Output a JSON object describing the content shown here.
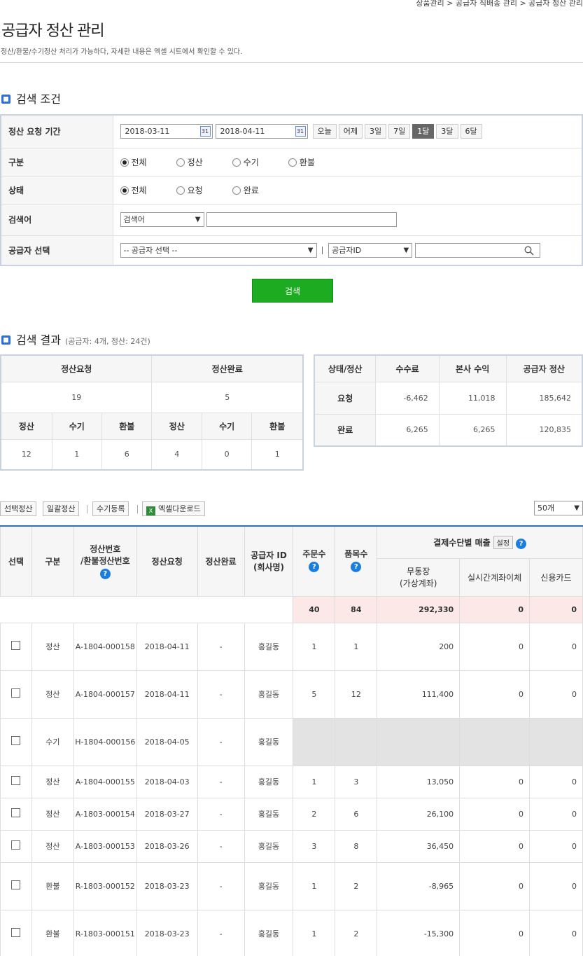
{
  "breadcrumb": "상품관리 > 공급자 직배송 관리 > 공급자 정산 관리",
  "title": "공급자 정산 관리",
  "description": "정산/환불/수기정산 처리가 가능하다, 자세한 내용은 엑셀 시트에서 확인할 수 있다.",
  "search_section": {
    "title": "검색 조건"
  },
  "search": {
    "period_label": "정산 요청 기간",
    "date_from": "2018-03-11",
    "date_to": "2018-04-11",
    "calendar_icon_text": "31",
    "period_buttons": [
      "오늘",
      "어제",
      "3일",
      "7일",
      "1달",
      "3달",
      "6달"
    ],
    "active_period": "1달",
    "type_label": "구분",
    "type_options": [
      "전체",
      "정산",
      "수기",
      "환불"
    ],
    "type_selected": "전체",
    "status_label": "상태",
    "status_options": [
      "전체",
      "요청",
      "완료"
    ],
    "status_selected": "전체",
    "keyword_label": "검색어",
    "keyword_select": "검색어",
    "keyword_value": "",
    "supplier_label": "공급자 선택",
    "supplier_select": "-- 공급자 선택 --",
    "supplier_id_select": "공급자ID",
    "supplier_search_value": "",
    "search_button": "검색"
  },
  "result_section": {
    "title": "검색 결과",
    "subtitle": "(공급자: 4개, 정산: 24건)"
  },
  "summary1": {
    "groups": [
      "정산요청",
      "정산완료"
    ],
    "group_totals": [
      "19",
      "5"
    ],
    "sub_headers": [
      "정산",
      "수기",
      "환불",
      "정산",
      "수기",
      "환불"
    ],
    "sub_values": [
      "12",
      "1",
      "6",
      "4",
      "0",
      "1"
    ]
  },
  "summary2": {
    "headers": [
      "상태/정산",
      "수수료",
      "본사 수익",
      "공급자 정산"
    ],
    "rows": [
      {
        "label": "요청",
        "fee": "-6,462",
        "hq": "11,018",
        "supplier": "185,642"
      },
      {
        "label": "완료",
        "fee": "6,265",
        "hq": "6,265",
        "supplier": "120,835"
      }
    ]
  },
  "actions": {
    "select_settle": "선택정산",
    "bulk_settle": "일괄정산",
    "manual_register": "수기등록",
    "excel_download": "엑셀다운로드",
    "excel_icon_text": "X",
    "page_size": "50개"
  },
  "list": {
    "headers": {
      "select": "선택",
      "type": "구분",
      "number_1": "정산번호",
      "number_2": "/환불정산번호",
      "request": "정산요청",
      "complete": "정산완료",
      "supplier_1": "공급자 ID",
      "supplier_2": "(회사명)",
      "orders": "주문수",
      "items": "품목수",
      "payment": "결제수단별 매출",
      "settings": "설정",
      "bank_1": "무통장",
      "bank_2": "(가상계좌)",
      "realtime": "실시간계좌이체",
      "card": "신용카드"
    },
    "help_icon": "?",
    "totals": {
      "orders": "40",
      "items": "84",
      "bank": "292,330",
      "realtime": "0",
      "card": "0"
    },
    "rows": [
      {
        "type": "정산",
        "number": "A-1804-000158",
        "request": "2018-04-11",
        "complete": "-",
        "supplier": "홍길동",
        "orders": "1",
        "items": "1",
        "bank": "200",
        "realtime": "0",
        "card": "0"
      },
      {
        "type": "정산",
        "number": "A-1804-000157",
        "request": "2018-04-11",
        "complete": "-",
        "supplier": "홍길동",
        "orders": "5",
        "items": "12",
        "bank": "111,400",
        "realtime": "0",
        "card": "0"
      },
      {
        "type": "수기",
        "number": "H-1804-000156",
        "request": "2018-04-05",
        "complete": "-",
        "supplier": "홍길동",
        "orders": "",
        "items": "",
        "bank": "",
        "realtime": "",
        "card": ""
      },
      {
        "type": "정산",
        "number": "A-1804-000155",
        "request": "2018-04-03",
        "complete": "-",
        "supplier": "홍길동",
        "orders": "1",
        "items": "3",
        "bank": "13,050",
        "realtime": "0",
        "card": "0"
      },
      {
        "type": "정산",
        "number": "A-1803-000154",
        "request": "2018-03-27",
        "complete": "-",
        "supplier": "홍길동",
        "orders": "2",
        "items": "6",
        "bank": "26,100",
        "realtime": "0",
        "card": "0"
      },
      {
        "type": "정산",
        "number": "A-1803-000153",
        "request": "2018-03-26",
        "complete": "-",
        "supplier": "홍길동",
        "orders": "3",
        "items": "8",
        "bank": "36,450",
        "realtime": "0",
        "card": "0"
      },
      {
        "type": "환불",
        "number": "R-1803-000152",
        "request": "2018-03-23",
        "complete": "-",
        "supplier": "홍길동",
        "orders": "1",
        "items": "2",
        "bank": "-8,965",
        "realtime": "0",
        "card": "0"
      },
      {
        "type": "환불",
        "number": "R-1803-000151",
        "request": "2018-03-23",
        "complete": "-",
        "supplier": "홍길동",
        "orders": "1",
        "items": "2",
        "bank": "-15,300",
        "realtime": "0",
        "card": "0"
      }
    ]
  }
}
